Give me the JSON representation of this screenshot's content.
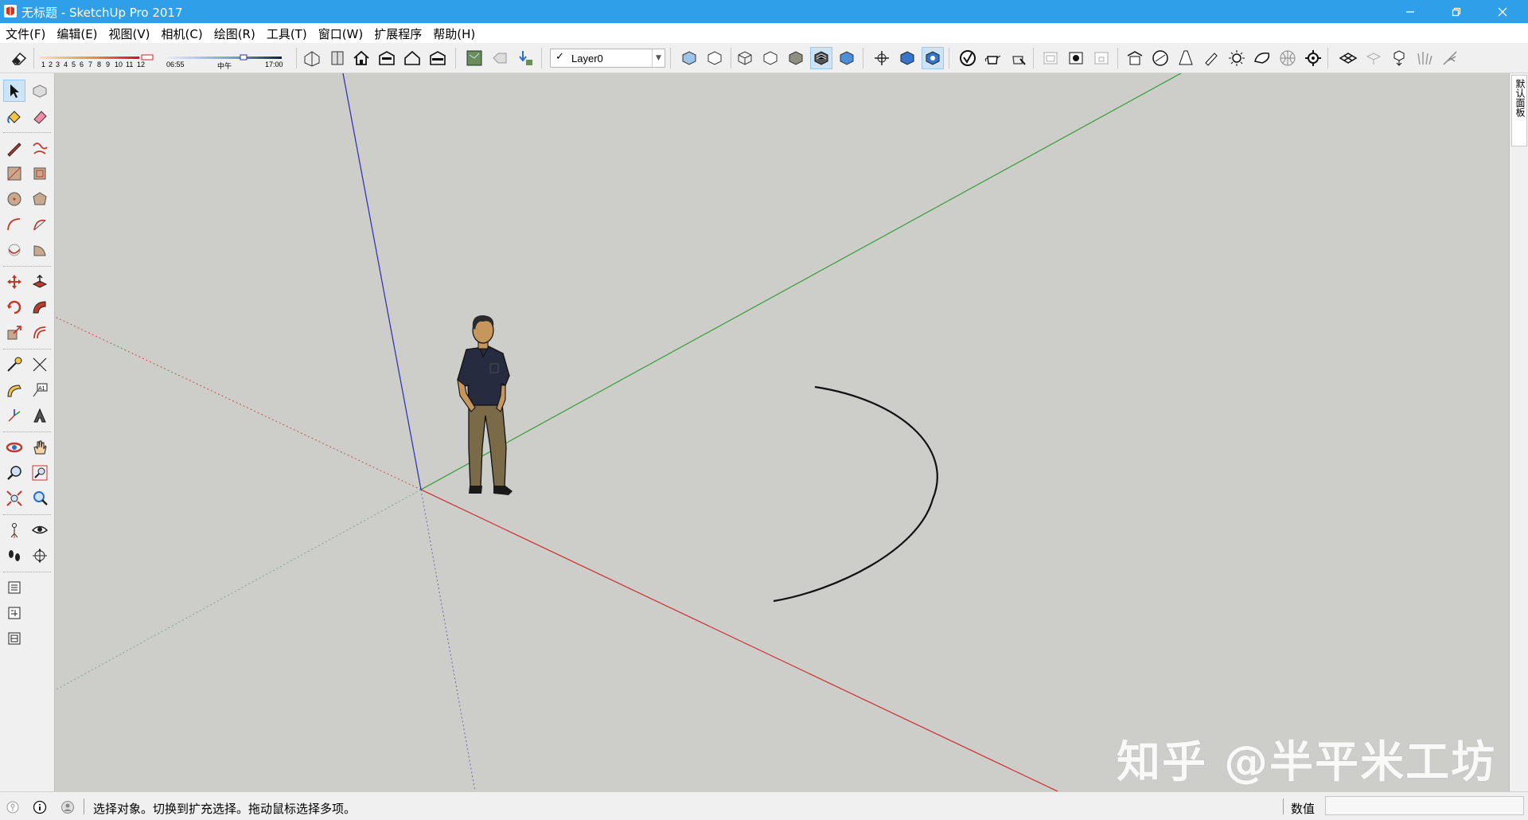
{
  "window": {
    "title": "无标题 - SketchUp Pro 2017",
    "controls": [
      "minimize-icon",
      "restore-icon",
      "close-icon"
    ]
  },
  "menubar": [
    {
      "label": "文件(F)"
    },
    {
      "label": "编辑(E)"
    },
    {
      "label": "视图(V)"
    },
    {
      "label": "相机(C)"
    },
    {
      "label": "绘图(R)"
    },
    {
      "label": "工具(T)"
    },
    {
      "label": "窗口(W)"
    },
    {
      "label": "扩展程序"
    },
    {
      "label": "帮助(H)"
    }
  ],
  "toolbar": {
    "shadow_months": [
      "1",
      "2",
      "3",
      "4",
      "5",
      "6",
      "7",
      "8",
      "9",
      "10",
      "11",
      "12"
    ],
    "shadow_time_start": "06:55",
    "shadow_time_mid": "中午",
    "shadow_time_end": "17:00",
    "layer": {
      "checked": true,
      "name": "Layer0"
    }
  },
  "scene": {
    "axis_colors": {
      "x": "#d22020",
      "y": "#2a9a2a",
      "z": "#2b2bb8"
    },
    "background": "#cdcdca",
    "objects": [
      "axes",
      "person-figure",
      "arc-curve"
    ]
  },
  "tray": {
    "tab_label": "默认面板"
  },
  "watermark": "知乎 @半平米工坊",
  "status": {
    "message": "选择对象。切换到扩充选择。拖动鼠标选择多项。",
    "measure_label": "数值",
    "measure_value": ""
  },
  "colors": {
    "titlebar": "#2e9fe8",
    "active_tool": "#cde4f7"
  }
}
